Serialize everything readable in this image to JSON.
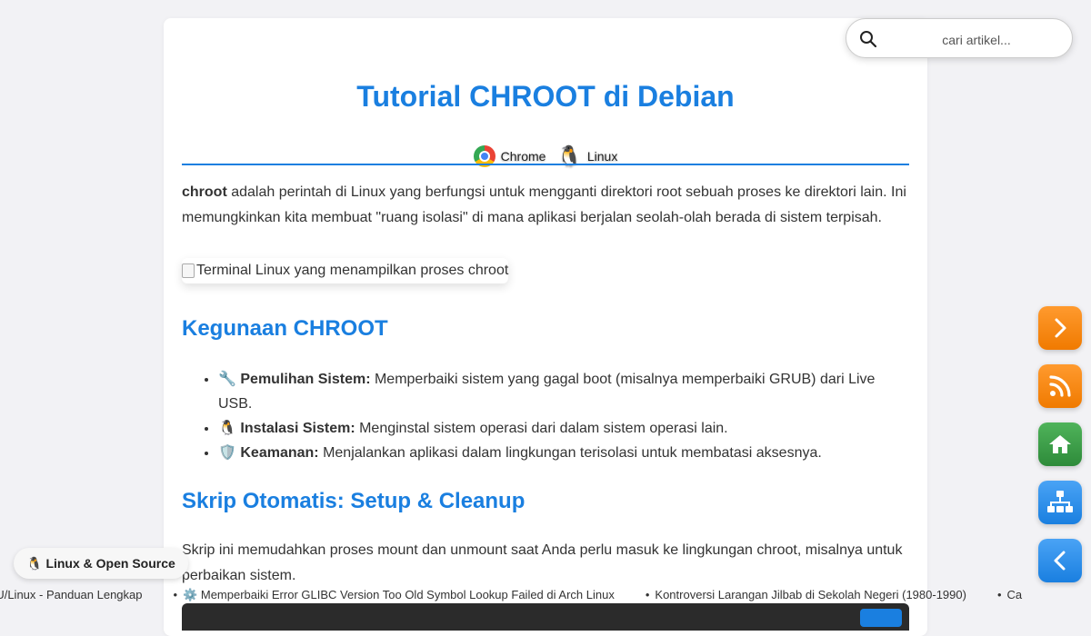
{
  "search": {
    "placeholder": "cari artikel..."
  },
  "article": {
    "title": "Tutorial CHROOT di Debian",
    "tags": [
      {
        "label": "Chrome",
        "icon": "chrome-icon"
      },
      {
        "label": "Linux",
        "icon": "tux-icon"
      }
    ],
    "intro": {
      "term": "chroot",
      "text": " adalah perintah di Linux yang berfungsi untuk mengganti direktori root sebuah proses ke direktori lain. Ini memungkinkan kita membuat \"ruang isolasi\" di mana aplikasi berjalan seolah-olah berada di sistem terpisah."
    },
    "image_alt": "Terminal Linux yang menampilkan proses chroot",
    "section1_heading": "Kegunaan CHROOT",
    "uses": [
      {
        "emoji": "🔧",
        "term": "Pemulihan Sistem:",
        "text": " Memperbaiki sistem yang gagal boot (misalnya memperbaiki GRUB) dari Live USB."
      },
      {
        "emoji": "🐧",
        "term": "Instalasi Sistem:",
        "text": " Menginstal sistem operasi dari dalam sistem operasi lain."
      },
      {
        "emoji": "🛡️",
        "term": "Keamanan:",
        "text": " Menjalankan aplikasi dalam lingkungan terisolasi untuk membatasi aksesnya."
      }
    ],
    "section2_heading": "Skrip Otomatis: Setup & Cleanup",
    "section2_text": "Skrip ini memudahkan proses mount dan unmount saat Anda perlu masuk ke lingkungan chroot, misalnya untuk perbaikan sistem."
  },
  "badge": {
    "emoji": "🐧",
    "label": "Linux & Open Source"
  },
  "ticker": [
    "Panduan Lengkap Instalasi Debian GNU/Linux - Panduan Lengkap",
    "⚙️ Memperbaiki Error GLIBC Version Too Old Symbol Lookup Failed di Arch Linux",
    "Kontroversi Larangan Jilbab di Sekolah Negeri (1980-1990)",
    "Ca"
  ],
  "fab_icons": [
    "chevron-right-icon",
    "rss-icon",
    "home-icon",
    "sitemap-icon",
    "chevron-left-icon"
  ],
  "colors": {
    "accent": "#1a7fe0",
    "orange": "#f58a0b",
    "green": "#3aa047"
  }
}
